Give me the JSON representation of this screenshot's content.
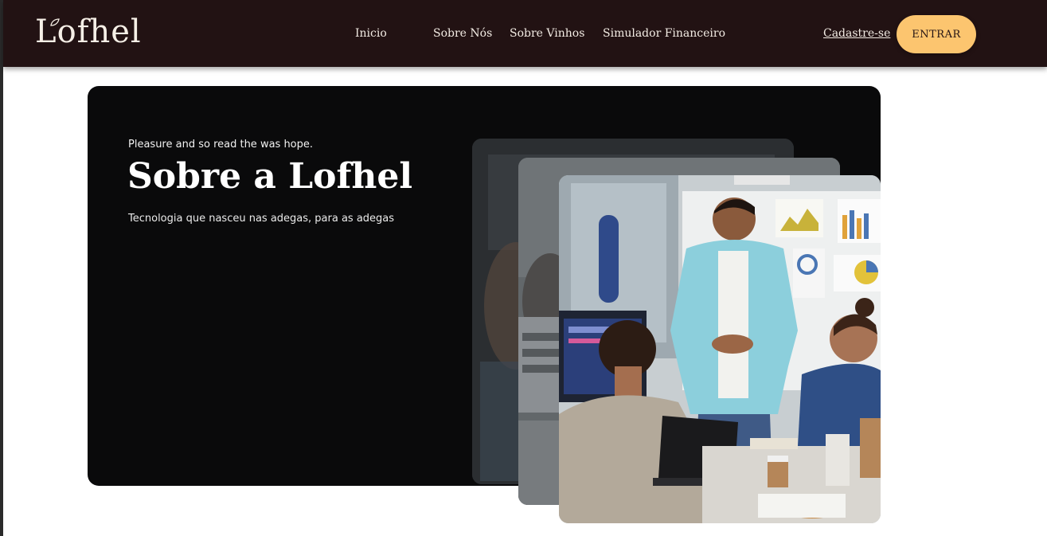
{
  "header": {
    "logo": "Lofhel",
    "nav": [
      "Inicio",
      "Sobre Nós",
      "Sobre Vinhos",
      "Simulador Financeiro"
    ],
    "signup": "Cadastre-se",
    "enter": "ENTRAR"
  },
  "hero": {
    "eyebrow": "Pleasure and so read the was hope.",
    "title": "Sobre a Lofhel",
    "subtitle": "Tecnologia que nasceu nas adegas, para as adegas"
  },
  "colors": {
    "header_bg": "#221213",
    "accent": "#fcc56f",
    "hero_bg": "#0a0a0b"
  },
  "images": {
    "hero_photo": "team-meeting-photo"
  }
}
